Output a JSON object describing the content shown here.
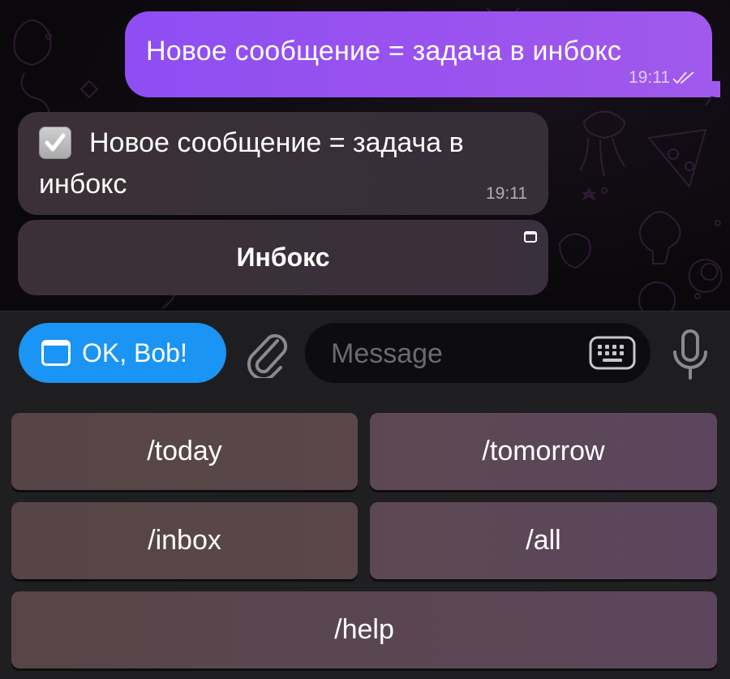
{
  "chat": {
    "outgoing_message": {
      "text": "Новое сообщение = задача в инбокс",
      "time": "19:11",
      "status_icon": "double-check-icon"
    },
    "incoming_message": {
      "line1": "Новое сообщение = задача в",
      "line2": "инбокс",
      "time": "19:11",
      "emoji_icon": "check-box-icon"
    },
    "inline_button": {
      "label": "Инбокс",
      "icon": "web-app-icon"
    }
  },
  "input_bar": {
    "menu_button_label": "OK, Bob!",
    "menu_button_icon": "web-app-icon",
    "attach_icon": "paperclip-icon",
    "message_placeholder": "Message",
    "keyboard_icon": "keyboard-icon",
    "mic_icon": "microphone-icon"
  },
  "reply_keyboard": {
    "buttons": [
      "/today",
      "/tomorrow",
      "/inbox",
      "/all",
      "/help"
    ]
  },
  "colors": {
    "outgoing_bubble": "#9b53ee",
    "menu_button": "#1a94f5",
    "incoming_bubble": "#3a3035",
    "keyboard_button": "#5a474b"
  }
}
